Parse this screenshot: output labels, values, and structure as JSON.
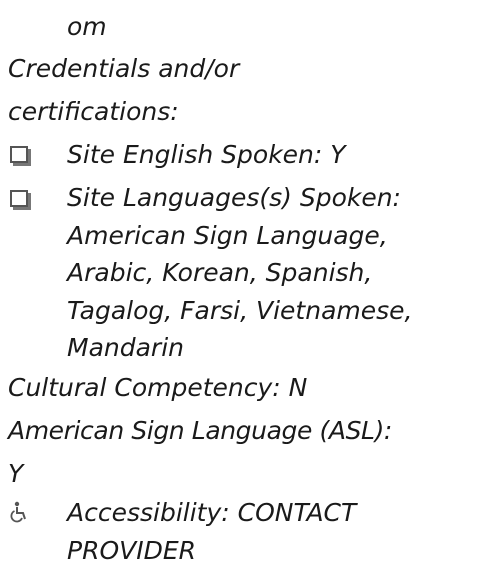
{
  "fragment": "om",
  "credentials": {
    "line1": "Credentials and/or",
    "line2": "certifications:"
  },
  "site_english": "Site English Spoken: Y",
  "site_languages": {
    "line1": "Site Languages(s) Spoken:",
    "line2": "American Sign Language,",
    "line3": "Arabic, Korean, Spanish,",
    "line4": "Tagalog, Farsi, Vietnamese,",
    "line5": "Mandarin"
  },
  "cultural_competency": "Cultural Competency: N",
  "asl": {
    "line1": "American Sign Language (ASL):",
    "line2": "Y"
  },
  "accessibility": {
    "line1": "Accessibility: CONTACT",
    "line2": "PROVIDER"
  },
  "icons": {
    "checkbox": "checkbox-icon",
    "accessibility": "wheelchair-icon"
  }
}
